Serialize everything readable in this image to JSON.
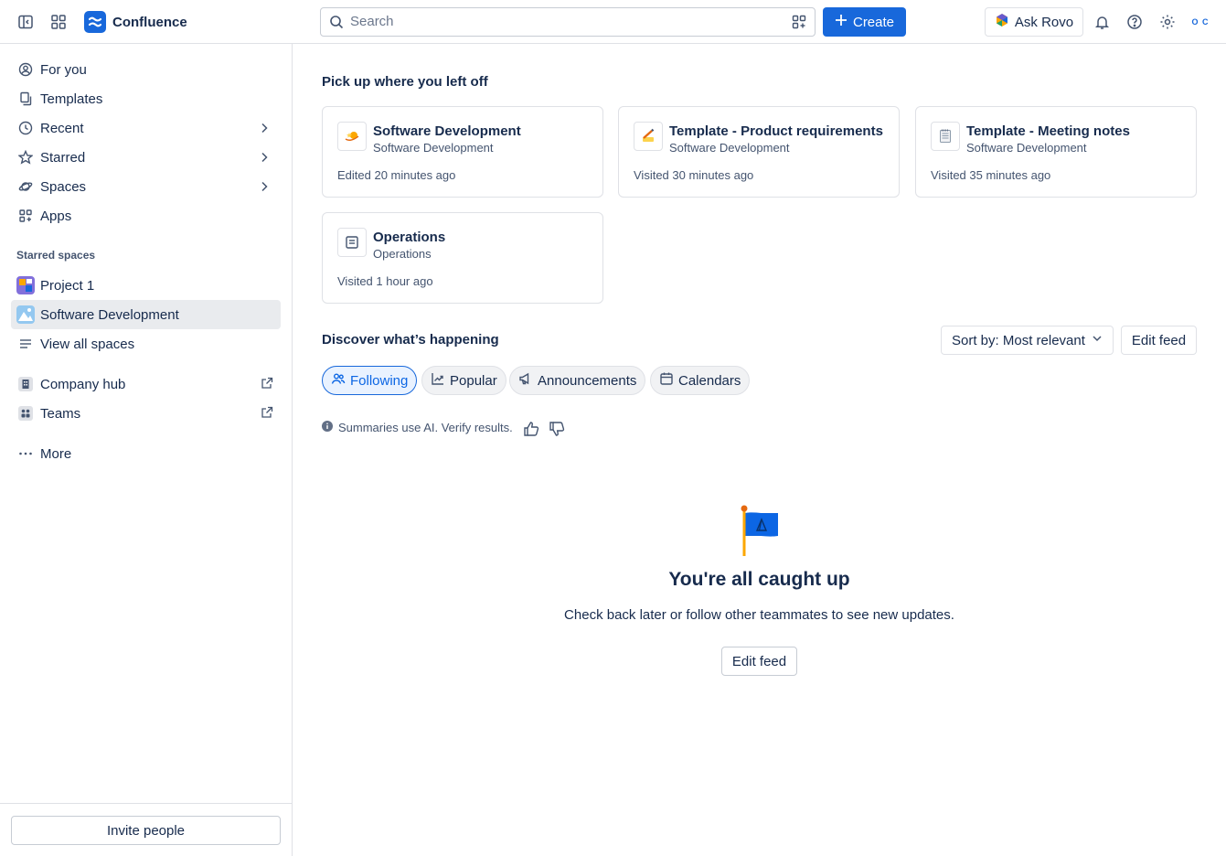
{
  "app": {
    "name": "Confluence"
  },
  "header": {
    "search_placeholder": "Search",
    "create_label": "Create",
    "rovo_label": "Ask Rovo",
    "avatar_text": "O C"
  },
  "sidebar": {
    "nav": [
      {
        "label": "For you",
        "icon": "user-circle-icon"
      },
      {
        "label": "Templates",
        "icon": "templates-icon"
      },
      {
        "label": "Recent",
        "icon": "clock-icon"
      },
      {
        "label": "Starred",
        "icon": "star-icon"
      },
      {
        "label": "Spaces",
        "icon": "planet-icon"
      },
      {
        "label": "Apps",
        "icon": "apps-icon"
      }
    ],
    "starred_spaces_label": "Starred spaces",
    "spaces": [
      {
        "label": "Project 1"
      },
      {
        "label": "Software Development"
      }
    ],
    "view_all_label": "View all spaces",
    "links": [
      {
        "label": "Company hub"
      },
      {
        "label": "Teams"
      }
    ],
    "more_label": "More",
    "invite_label": "Invite people"
  },
  "main": {
    "pickup_title": "Pick up where you left off",
    "cards": [
      {
        "title": "Software Development",
        "subtitle": "Software Development",
        "meta": "Edited 20 minutes ago",
        "icon": "space-icon"
      },
      {
        "title": "Template - Product requirements",
        "subtitle": "Software Development",
        "meta": "Visited 30 minutes ago",
        "icon": "pencil-emoji-icon"
      },
      {
        "title": "Template - Meeting notes",
        "subtitle": "Software Development",
        "meta": "Visited 35 minutes ago",
        "icon": "notepad-emoji-icon"
      },
      {
        "title": "Operations",
        "subtitle": "Operations",
        "meta": "Visited 1 hour ago",
        "icon": "page-icon"
      }
    ],
    "discover_title": "Discover what’s happening",
    "sort_label": "Sort by: Most relevant",
    "edit_feed_label": "Edit feed",
    "chips": [
      {
        "label": "Following",
        "active": true
      },
      {
        "label": "Popular"
      },
      {
        "label": "Announcements"
      },
      {
        "label": "Calendars"
      }
    ],
    "ai_note": "Summaries use AI. Verify results.",
    "empty_title": "You're all caught up",
    "empty_subtitle": "Check back later or follow other teammates to see new updates.",
    "empty_button": "Edit feed"
  },
  "colors": {
    "brand": "#1868db",
    "text": "#172b4d",
    "subtle": "#44546f",
    "border": "#dfe1e6"
  }
}
